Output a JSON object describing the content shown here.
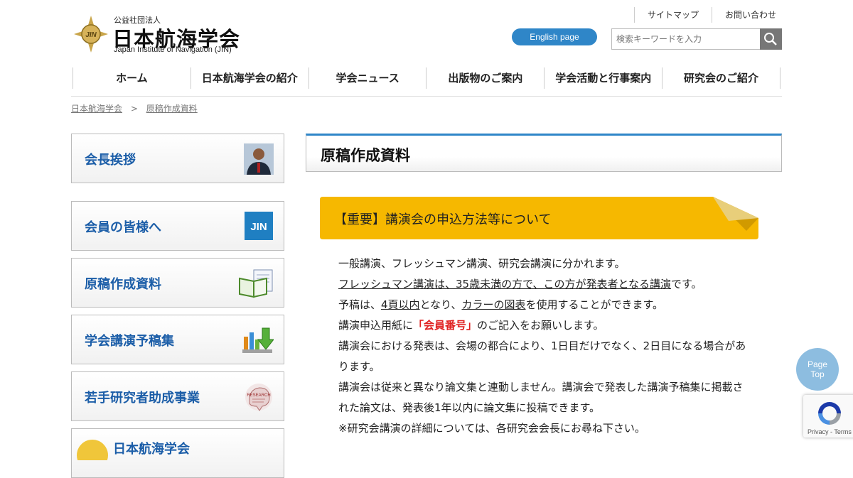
{
  "logo": {
    "sub": "公益社団法人",
    "name": "日本航海学会",
    "en": "Japan Institute of Navigation (JIN)",
    "mark_text": "JIN"
  },
  "toplinks": [
    "サイトマップ",
    "お問い合わせ"
  ],
  "english_label": "English page",
  "search": {
    "placeholder": "検索キーワードを入力",
    "icon": "search-icon"
  },
  "nav": [
    "ホーム",
    "日本航海学会の紹介",
    "学会ニュース",
    "出版物のご案内",
    "学会活動と行事案内",
    "研究会のご紹介"
  ],
  "breadcrumb": [
    "日本航海学会",
    "原稿作成資料"
  ],
  "breadcrumb_sep": ">",
  "sidebar": [
    {
      "label": "会長挨拶",
      "icon": "president-photo"
    },
    {
      "label": "会員の皆様へ",
      "icon": "jin-logo-icon",
      "icon_text": "JIN"
    },
    {
      "label": "原稿作成資料",
      "icon": "document-icon"
    },
    {
      "label": "学会講演予稿集",
      "icon": "download-icon"
    },
    {
      "label": "若手研究者助成事業",
      "icon": "research-icon"
    },
    {
      "label": "日本航海学会",
      "icon": "globe-icon"
    }
  ],
  "page_title": "原稿作成資料",
  "banner": "【重要】講演会の申込方法等について",
  "content": {
    "p1": "一般講演、フレッシュマン講演、研究会講演に分かれます。",
    "p2_u": "フレッシュマン講演は、35歳未満の方で、この方が発表者となる講演",
    "p2_tail": "です。",
    "p3_a": "予稿は、",
    "p3_u1": "4頁以内",
    "p3_b": "となり、",
    "p3_u2": "カラーの図表",
    "p3_c": "を使用することができます。",
    "p4_a": "講演申込用紙に",
    "p4_red": "「会員番号」",
    "p4_b": "のご記入をお願いします。",
    "p5": "講演会における発表は、会場の都合により、1日目だけでなく、2日目になる場合があります。",
    "p6": "講演会は従来と異なり論文集と連動しません。講演会で発表した講演予稿集に掲載された論文は、発表後1年以内に論文集に投稿できます。",
    "p7": "※研究会講演の詳細については、各研究会会長にお尋ね下さい。"
  },
  "pagetop": [
    "Page",
    "Top"
  ],
  "recaptcha_terms": "Privacy - Terms",
  "colors": {
    "accent": "#2f86c8",
    "banner": "#f6b800",
    "sidebar_text": "#1c5ea8",
    "highlight": "#e02020"
  }
}
